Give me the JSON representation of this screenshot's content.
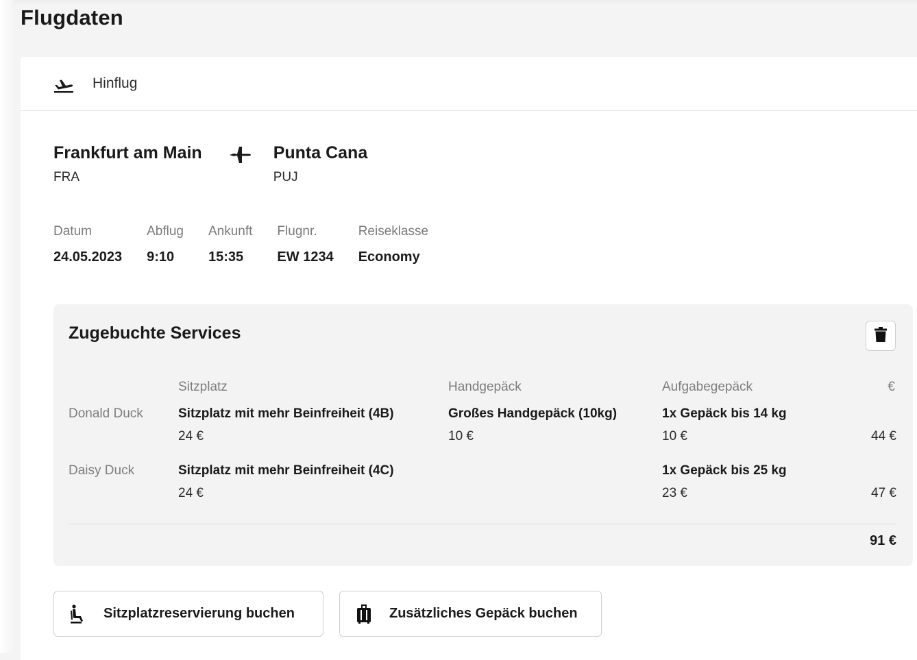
{
  "page": {
    "title": "Flugdaten"
  },
  "flight": {
    "direction_label": "Hinflug",
    "origin": {
      "city": "Frankfurt am Main",
      "code": "FRA"
    },
    "destination": {
      "city": "Punta Cana",
      "code": "PUJ"
    },
    "details": [
      {
        "label": "Datum",
        "value": "24.05.2023"
      },
      {
        "label": "Abflug",
        "value": "9:10"
      },
      {
        "label": "Ankunft",
        "value": "15:35"
      },
      {
        "label": "Flugnr.",
        "value": "EW 1234"
      },
      {
        "label": "Reiseklasse",
        "value": "Economy"
      }
    ]
  },
  "services": {
    "title": "Zugebuchte Services",
    "columns": {
      "seat": "Sitzplatz",
      "hand_luggage": "Handgepäck",
      "checked_luggage": "Aufgabegepäck",
      "currency": "€"
    },
    "passengers": [
      {
        "name": "Donald Duck",
        "seat": {
          "title": "Sitzplatz mit mehr Beinfreiheit (4B)",
          "price": "24 €"
        },
        "hand_luggage": {
          "title": "Großes Handgepäck (10kg)",
          "price": "10 €"
        },
        "checked_luggage": {
          "title": "1x Gepäck bis 14 kg",
          "price": "10 €"
        },
        "sum": "44 €"
      },
      {
        "name": "Daisy Duck",
        "seat": {
          "title": "Sitzplatz mit mehr Beinfreiheit (4C)",
          "price": "24 €"
        },
        "checked_luggage": {
          "title": "1x Gepäck bis 25 kg",
          "price": "23 €"
        },
        "sum": "47 €"
      }
    ],
    "total": "91 €"
  },
  "actions": {
    "seat_button": "Sitzplatzreservierung buchen",
    "luggage_button": "Zusätzliches Gepäck buchen"
  },
  "icons": {
    "header": "flight-takeoff-icon",
    "route": "airplane-icon",
    "delete": "trash-icon",
    "seat": "seat-icon",
    "luggage": "luggage-icon"
  }
}
